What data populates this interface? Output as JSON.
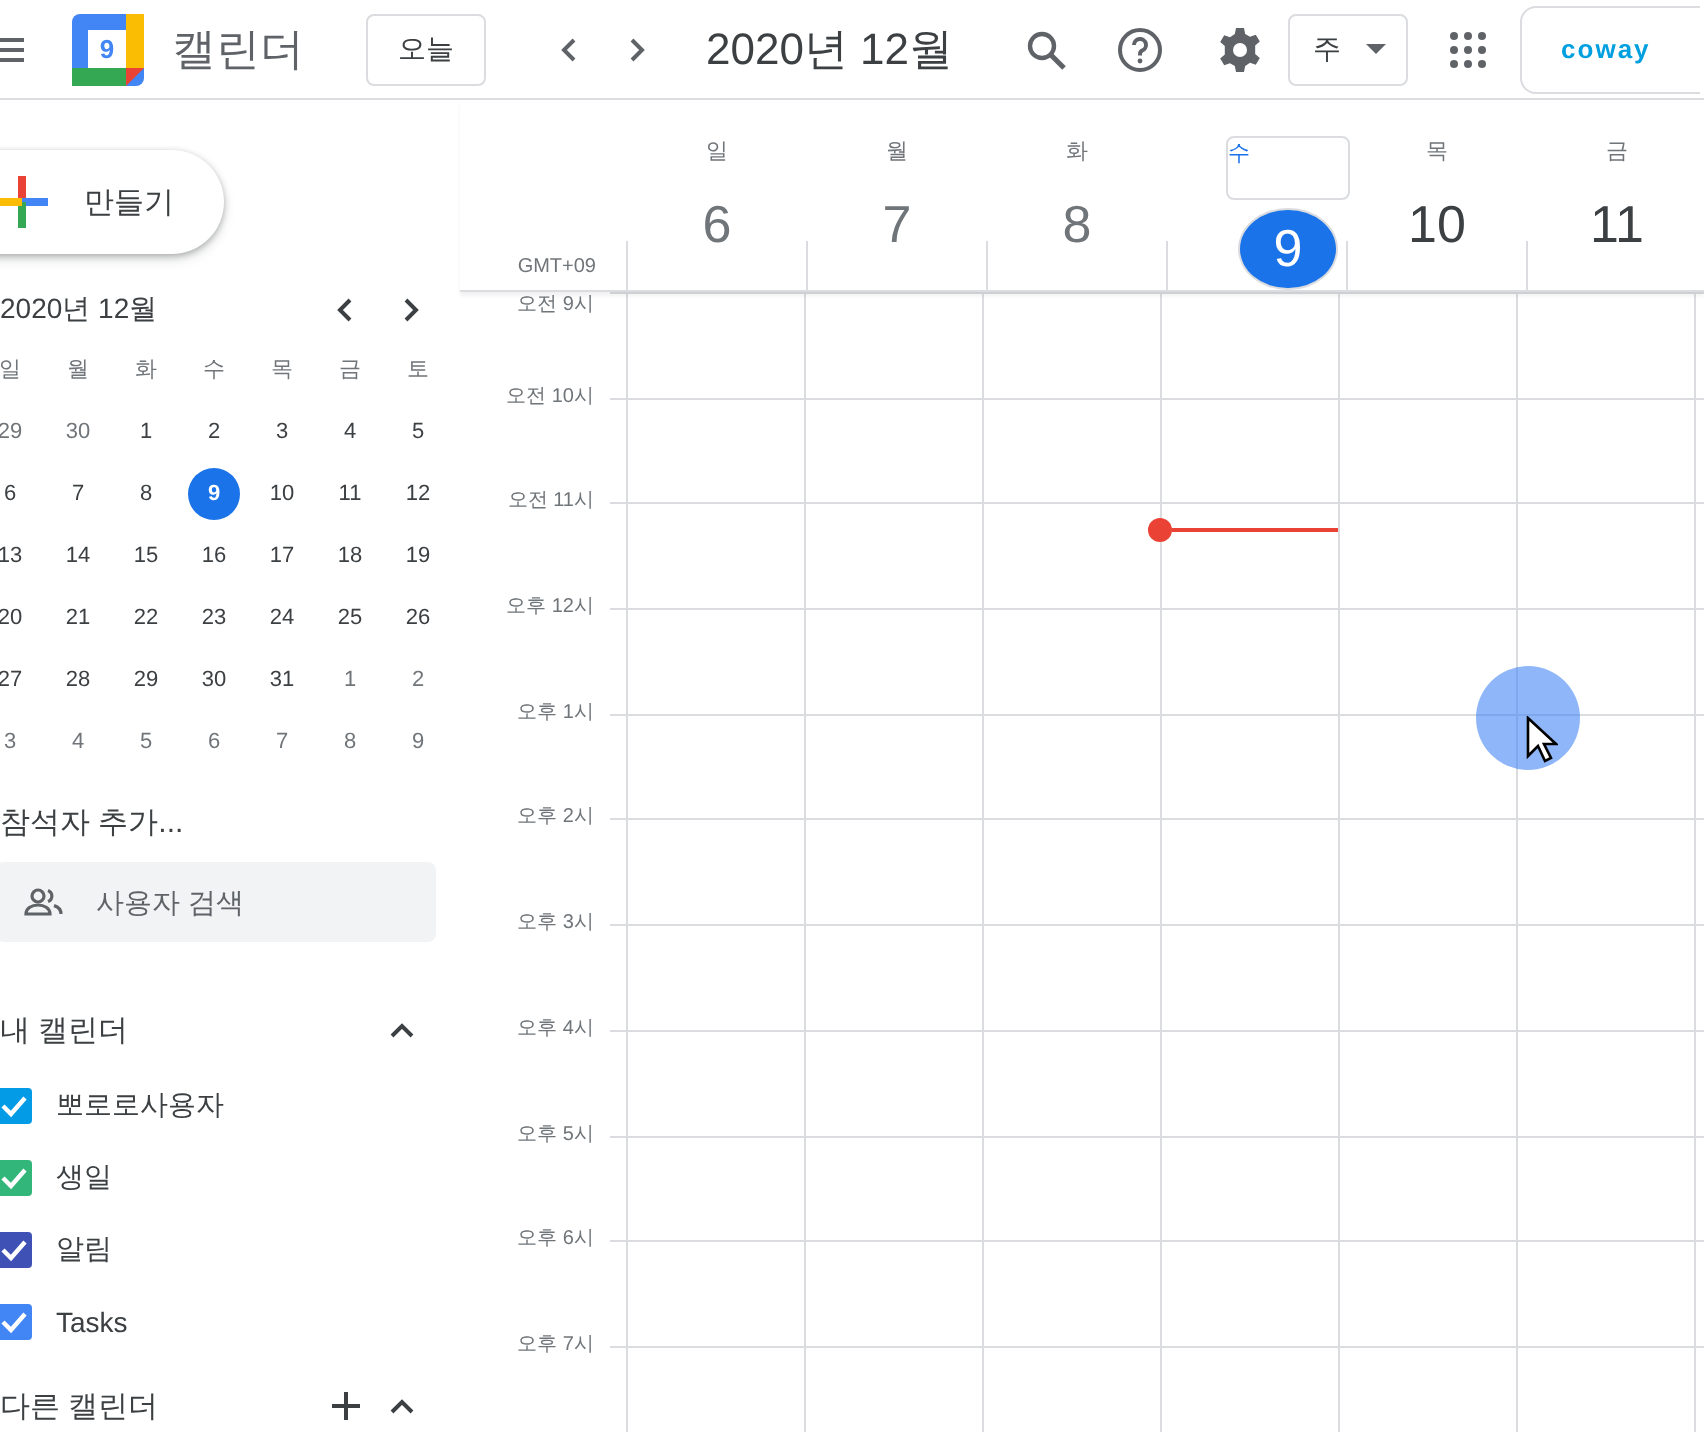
{
  "app_title": "캘린더",
  "logo_day": "9",
  "today_button": "오늘",
  "period_title": "2020년 12월",
  "view_select": "주",
  "account_brand": "coway",
  "create_button": "만들기",
  "mini_calendar": {
    "title": "2020년 12월",
    "weekdays": [
      "일",
      "월",
      "화",
      "수",
      "목",
      "금",
      "토"
    ],
    "weeks": [
      [
        {
          "day": "29",
          "muted": true,
          "selected": false
        },
        {
          "day": "30",
          "muted": true,
          "selected": false
        },
        {
          "day": "1",
          "muted": false,
          "selected": false
        },
        {
          "day": "2",
          "muted": false,
          "selected": false
        },
        {
          "day": "3",
          "muted": false,
          "selected": false
        },
        {
          "day": "4",
          "muted": false,
          "selected": false
        },
        {
          "day": "5",
          "muted": false,
          "selected": false
        }
      ],
      [
        {
          "day": "6",
          "muted": false,
          "selected": false
        },
        {
          "day": "7",
          "muted": false,
          "selected": false
        },
        {
          "day": "8",
          "muted": false,
          "selected": false
        },
        {
          "day": "9",
          "muted": false,
          "selected": true
        },
        {
          "day": "10",
          "muted": false,
          "selected": false
        },
        {
          "day": "11",
          "muted": false,
          "selected": false
        },
        {
          "day": "12",
          "muted": false,
          "selected": false
        }
      ],
      [
        {
          "day": "13",
          "muted": false,
          "selected": false
        },
        {
          "day": "14",
          "muted": false,
          "selected": false
        },
        {
          "day": "15",
          "muted": false,
          "selected": false
        },
        {
          "day": "16",
          "muted": false,
          "selected": false
        },
        {
          "day": "17",
          "muted": false,
          "selected": false
        },
        {
          "day": "18",
          "muted": false,
          "selected": false
        },
        {
          "day": "19",
          "muted": false,
          "selected": false
        }
      ],
      [
        {
          "day": "20",
          "muted": false,
          "selected": false
        },
        {
          "day": "21",
          "muted": false,
          "selected": false
        },
        {
          "day": "22",
          "muted": false,
          "selected": false
        },
        {
          "day": "23",
          "muted": false,
          "selected": false
        },
        {
          "day": "24",
          "muted": false,
          "selected": false
        },
        {
          "day": "25",
          "muted": false,
          "selected": false
        },
        {
          "day": "26",
          "muted": false,
          "selected": false
        }
      ],
      [
        {
          "day": "27",
          "muted": false,
          "selected": false
        },
        {
          "day": "28",
          "muted": false,
          "selected": false
        },
        {
          "day": "29",
          "muted": false,
          "selected": false
        },
        {
          "day": "30",
          "muted": false,
          "selected": false
        },
        {
          "day": "31",
          "muted": false,
          "selected": false
        },
        {
          "day": "1",
          "muted": true,
          "selected": false
        },
        {
          "day": "2",
          "muted": true,
          "selected": false
        }
      ],
      [
        {
          "day": "3",
          "muted": true,
          "selected": false
        },
        {
          "day": "4",
          "muted": true,
          "selected": false
        },
        {
          "day": "5",
          "muted": true,
          "selected": false
        },
        {
          "day": "6",
          "muted": true,
          "selected": false
        },
        {
          "day": "7",
          "muted": true,
          "selected": false
        },
        {
          "day": "8",
          "muted": true,
          "selected": false
        },
        {
          "day": "9",
          "muted": true,
          "selected": false
        }
      ]
    ]
  },
  "add_guests_label": "참석자 추가...",
  "people_search": {
    "placeholder": "사용자 검색"
  },
  "my_calendars": {
    "title": "내 캘린더",
    "expanded": true,
    "items": [
      {
        "name": "뽀로로사용자",
        "checked": true,
        "color": "#039be5"
      },
      {
        "name": "생일",
        "checked": true,
        "color": "#33b679"
      },
      {
        "name": "알림",
        "checked": true,
        "color": "#3f51b5"
      },
      {
        "name": "Tasks",
        "checked": true,
        "color": "#4285f4"
      }
    ]
  },
  "other_calendars": {
    "title": "다른 캘린더",
    "expanded": true
  },
  "timezone": "GMT+09",
  "days": [
    {
      "name": "일",
      "date": "6",
      "past": true,
      "selected": false
    },
    {
      "name": "월",
      "date": "7",
      "past": true,
      "selected": false
    },
    {
      "name": "화",
      "date": "8",
      "past": true,
      "selected": false
    },
    {
      "name": "수",
      "date": "9",
      "past": false,
      "selected": true
    },
    {
      "name": "목",
      "date": "10",
      "past": false,
      "selected": false
    },
    {
      "name": "금",
      "date": "11",
      "past": false,
      "selected": false
    }
  ],
  "hours": [
    "오전 9시",
    "오전 10시",
    "오전 11시",
    "오후 12시",
    "오후 1시",
    "오후 2시",
    "오후 3시",
    "오후 4시",
    "오후 5시",
    "오후 6시",
    "오후 7시"
  ]
}
